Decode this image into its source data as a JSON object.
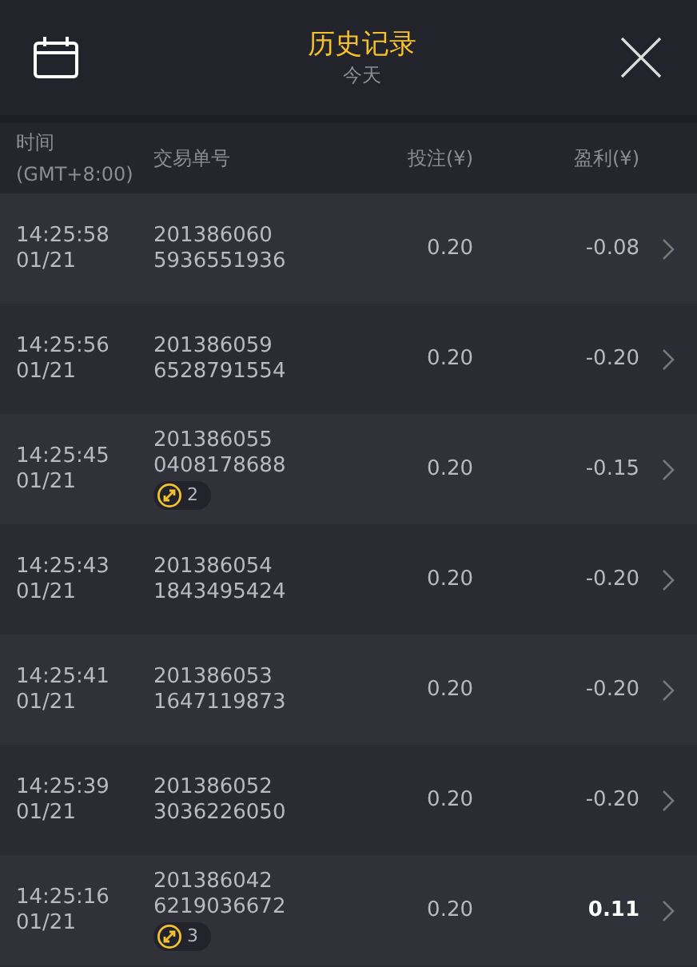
{
  "header": {
    "title": "历史记录",
    "subtitle": "今天"
  },
  "columns": [
    {
      "label": "时间",
      "sublabel": "(GMT+8:00)"
    },
    {
      "label": "交易单号"
    },
    {
      "label": "投注(¥)"
    },
    {
      "label": "盈利(¥)"
    }
  ],
  "rows": [
    {
      "time": "14:25:58",
      "date": "01/21",
      "order_1": "201386060",
      "order_2": "5936551936",
      "stake": "0.20",
      "profit": "-0.08",
      "win": false
    },
    {
      "time": "14:25:56",
      "date": "01/21",
      "order_1": "201386059",
      "order_2": "6528791554",
      "stake": "0.20",
      "profit": "-0.20",
      "win": false
    },
    {
      "time": "14:25:45",
      "date": "01/21",
      "order_1": "201386055",
      "order_2": "0408178688",
      "badge": "2",
      "stake": "0.20",
      "profit": "-0.15",
      "win": false
    },
    {
      "time": "14:25:43",
      "date": "01/21",
      "order_1": "201386054",
      "order_2": "1843495424",
      "stake": "0.20",
      "profit": "-0.20",
      "win": false
    },
    {
      "time": "14:25:41",
      "date": "01/21",
      "order_1": "201386053",
      "order_2": "1647119873",
      "stake": "0.20",
      "profit": "-0.20",
      "win": false
    },
    {
      "time": "14:25:39",
      "date": "01/21",
      "order_1": "201386052",
      "order_2": "3036226050",
      "stake": "0.20",
      "profit": "-0.20",
      "win": false
    },
    {
      "time": "14:25:16",
      "date": "01/21",
      "order_1": "201386042",
      "order_2": "6219036672",
      "badge": "3",
      "stake": "0.20",
      "profit": "0.11",
      "win": true
    }
  ]
}
